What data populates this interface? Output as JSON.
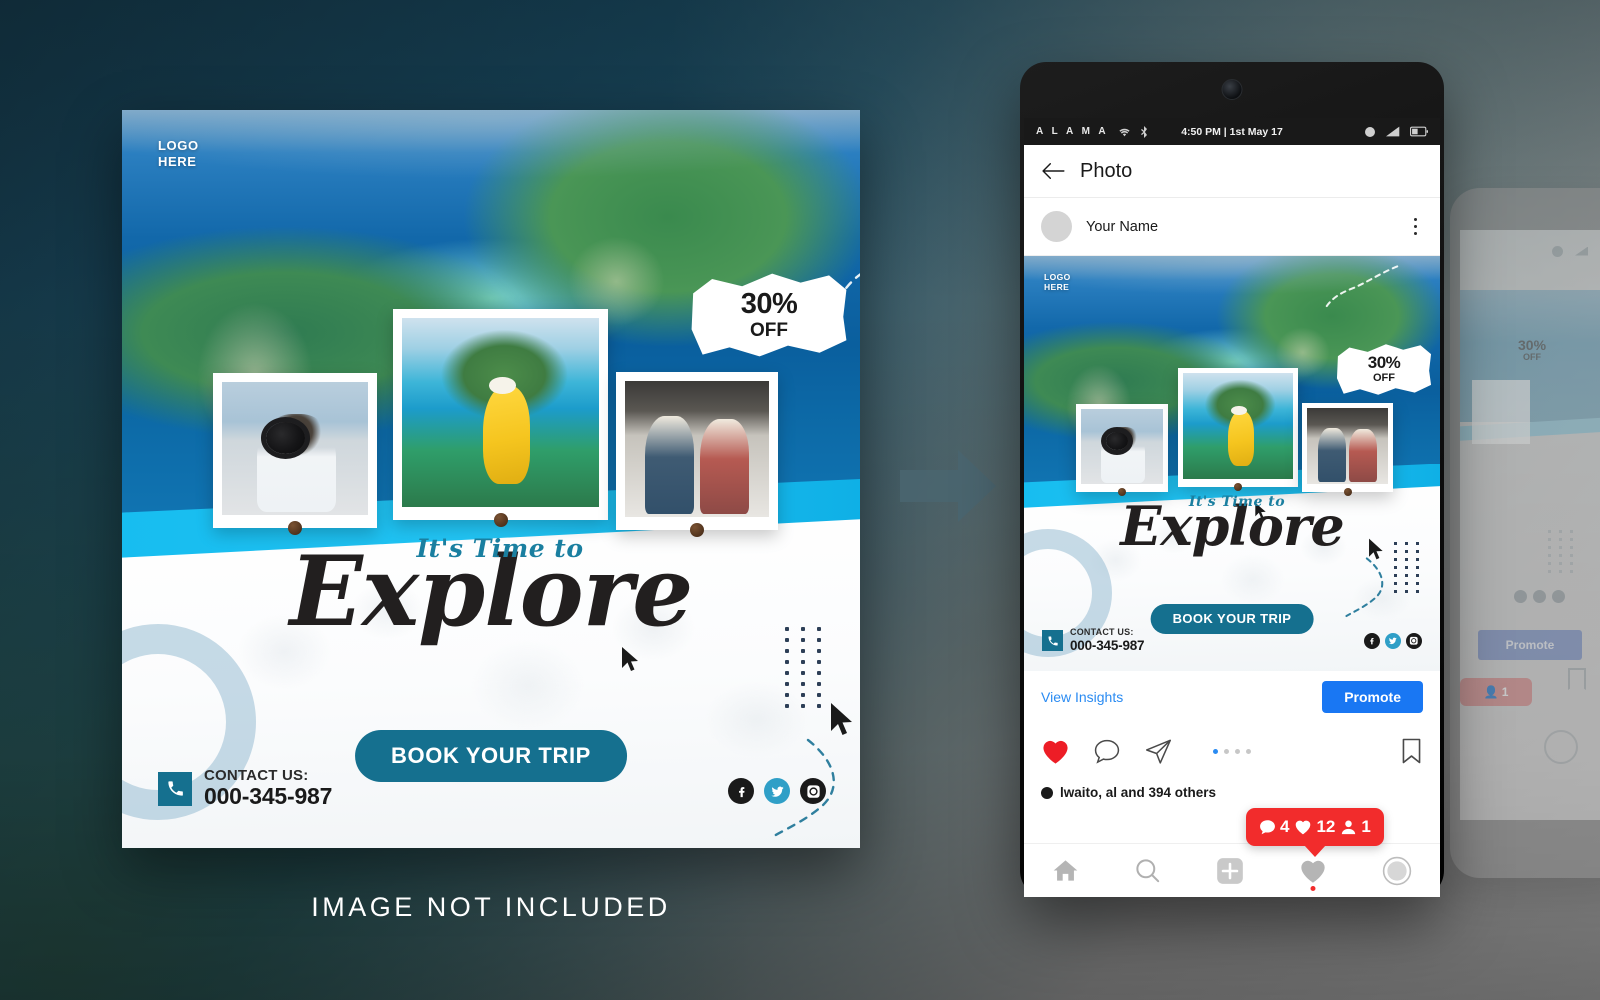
{
  "caption": "IMAGE NOT INCLUDED",
  "poster": {
    "logo": {
      "line1": "LOGO",
      "line2": "HERE"
    },
    "badge": {
      "percent": "30%",
      "off": "OFF"
    },
    "headline_small": "It's Time to",
    "headline_main": "Explore",
    "cta_label": "BOOK YOUR TRIP",
    "contact": {
      "label": "CONTACT US:",
      "number": "000-345-987"
    },
    "socials": [
      {
        "name": "facebook",
        "icon": "facebook-icon"
      },
      {
        "name": "twitter",
        "icon": "twitter-icon"
      },
      {
        "name": "instagram",
        "icon": "instagram-icon"
      }
    ],
    "photos": [
      {
        "name": "photographer-photo"
      },
      {
        "name": "yellow-dress-viewpoint-photo"
      },
      {
        "name": "couple-with-map-photo"
      }
    ],
    "colors": {
      "teal": "#15708f",
      "cyan": "#17bdf0",
      "script_accent": "#1a7fa0",
      "ink": "#221f1f"
    }
  },
  "phone": {
    "status_bar": {
      "carrier": "A L A M A",
      "time_date": "4:50 PM | 1st May 17",
      "icons": [
        "wifi-icon",
        "bluetooth-icon",
        "alarm-icon",
        "signal-icon",
        "battery-icon"
      ]
    },
    "app_header": {
      "back": "back-arrow-icon",
      "title": "Photo"
    },
    "user_row": {
      "name": "Your Name",
      "menu": "kebab-menu-icon"
    },
    "insights": {
      "link": "View Insights",
      "promote": "Promote"
    },
    "actions": {
      "like": "heart-filled-icon",
      "comment": "comment-icon",
      "share": "share-icon",
      "bookmark": "bookmark-icon",
      "carousel_dots": 4,
      "carousel_active": 1
    },
    "notification": {
      "comments": "4",
      "likes": "12",
      "followers": "1",
      "color": "#f22c2c"
    },
    "likes_text": "lwaito, al  and 394 others",
    "tab_bar": [
      {
        "name": "home",
        "icon": "home-icon"
      },
      {
        "name": "search",
        "icon": "search-icon"
      },
      {
        "name": "add",
        "icon": "plus-icon"
      },
      {
        "name": "activity",
        "icon": "heart-icon"
      },
      {
        "name": "profile",
        "icon": "profile-icon"
      }
    ],
    "colors": {
      "promote_blue": "#1977f3",
      "link_blue": "#2a8bf2"
    }
  },
  "flow": {
    "arrow": "right-arrow-icon"
  }
}
